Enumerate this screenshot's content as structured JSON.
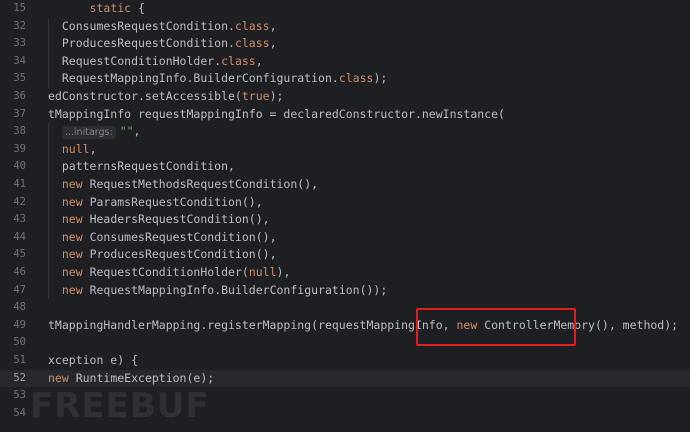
{
  "editor": {
    "lines": [
      {
        "num": "15",
        "indent": "      ",
        "segs": [
          {
            "t": "static",
            "c": "kw"
          },
          {
            "t": " {",
            "c": "plain"
          }
        ]
      },
      {
        "num": "32",
        "indent": "  ",
        "segs": [
          {
            "t": "ConsumesRequestCondition.",
            "c": "plain"
          },
          {
            "t": "class",
            "c": "kw"
          },
          {
            "t": ",",
            "c": "plain"
          }
        ]
      },
      {
        "num": "33",
        "indent": "  ",
        "segs": [
          {
            "t": "ProducesRequestCondition.",
            "c": "plain"
          },
          {
            "t": "class",
            "c": "kw"
          },
          {
            "t": ",",
            "c": "plain"
          }
        ]
      },
      {
        "num": "34",
        "indent": "  ",
        "segs": [
          {
            "t": "RequestConditionHolder.",
            "c": "plain"
          },
          {
            "t": "class",
            "c": "kw"
          },
          {
            "t": ",",
            "c": "plain"
          }
        ]
      },
      {
        "num": "35",
        "indent": "  ",
        "segs": [
          {
            "t": "RequestMappingInfo.BuilderConfiguration.",
            "c": "plain"
          },
          {
            "t": "class",
            "c": "kw"
          },
          {
            "t": ");",
            "c": "plain"
          }
        ]
      },
      {
        "num": "36",
        "indent": "",
        "segs": [
          {
            "t": "edConstructor.setAccessible(",
            "c": "plain"
          },
          {
            "t": "true",
            "c": "kw"
          },
          {
            "t": ");",
            "c": "plain"
          }
        ]
      },
      {
        "num": "37",
        "indent": "",
        "segs": [
          {
            "t": "tMappingInfo requestMappingInfo = declaredConstructor.newInstance(",
            "c": "plain"
          }
        ]
      },
      {
        "num": "38",
        "indent": "  ",
        "hint": "...initargs:",
        "segs": [
          {
            "t": "\"\"",
            "c": "str"
          },
          {
            "t": ",",
            "c": "plain"
          }
        ]
      },
      {
        "num": "39",
        "indent": "  ",
        "segs": [
          {
            "t": "null",
            "c": "kw"
          },
          {
            "t": ",",
            "c": "plain"
          }
        ]
      },
      {
        "num": "40",
        "indent": "  ",
        "segs": [
          {
            "t": "patternsRequestCondition,",
            "c": "plain"
          }
        ]
      },
      {
        "num": "41",
        "indent": "  ",
        "segs": [
          {
            "t": "new",
            "c": "kw"
          },
          {
            "t": " RequestMethodsRequestCondition(),",
            "c": "plain"
          }
        ]
      },
      {
        "num": "42",
        "indent": "  ",
        "segs": [
          {
            "t": "new",
            "c": "kw"
          },
          {
            "t": " ParamsRequestCondition(),",
            "c": "plain"
          }
        ]
      },
      {
        "num": "43",
        "indent": "  ",
        "segs": [
          {
            "t": "new",
            "c": "kw"
          },
          {
            "t": " HeadersRequestCondition(),",
            "c": "plain"
          }
        ]
      },
      {
        "num": "44",
        "indent": "  ",
        "segs": [
          {
            "t": "new",
            "c": "kw"
          },
          {
            "t": " ConsumesRequestCondition(),",
            "c": "plain"
          }
        ]
      },
      {
        "num": "45",
        "indent": "  ",
        "segs": [
          {
            "t": "new",
            "c": "kw"
          },
          {
            "t": " ProducesRequestCondition(),",
            "c": "plain"
          }
        ]
      },
      {
        "num": "46",
        "indent": "  ",
        "segs": [
          {
            "t": "new",
            "c": "kw"
          },
          {
            "t": " RequestConditionHolder(",
            "c": "plain"
          },
          {
            "t": "null",
            "c": "kw"
          },
          {
            "t": "),",
            "c": "plain"
          }
        ]
      },
      {
        "num": "47",
        "indent": "  ",
        "segs": [
          {
            "t": "new",
            "c": "kw"
          },
          {
            "t": " RequestMappingInfo.BuilderConfiguration());",
            "c": "plain"
          }
        ]
      },
      {
        "num": "48",
        "indent": "",
        "segs": []
      },
      {
        "num": "49",
        "indent": "",
        "segs": [
          {
            "t": "tMappingHandlerMapping.registerMapping(requestMappingInfo, ",
            "c": "plain"
          },
          {
            "t": "new",
            "c": "kw"
          },
          {
            "t": " ControllerMemory(), method);",
            "c": "plain"
          }
        ]
      },
      {
        "num": "50",
        "indent": "",
        "segs": []
      },
      {
        "num": "51",
        "indent": "",
        "segs": [
          {
            "t": "xception e) {",
            "c": "plain"
          }
        ]
      },
      {
        "num": "52",
        "indent": "",
        "current": true,
        "segs": [
          {
            "t": "new",
            "c": "kw"
          },
          {
            "t": " RuntimeException(e);",
            "c": "plain"
          }
        ]
      },
      {
        "num": "53",
        "indent": "",
        "segs": []
      },
      {
        "num": "54",
        "indent": "",
        "segs": []
      }
    ]
  },
  "watermark": "FREEBUF",
  "colors": {
    "background": "#1e1f22",
    "keyword": "#cf8e6d",
    "string": "#6aab73",
    "highlight_box": "#e0201f"
  }
}
